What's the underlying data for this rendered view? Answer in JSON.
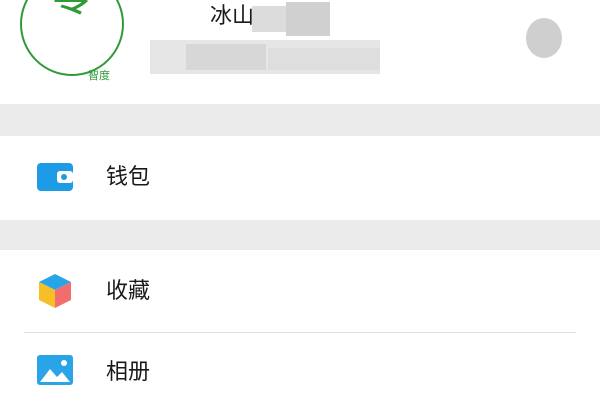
{
  "profile": {
    "avatar_glyph": "零",
    "avatar_caption": "智度",
    "name": "冰山"
  },
  "menu": {
    "items": [
      {
        "label": "钱包",
        "icon": "wallet-icon"
      },
      {
        "label": "收藏",
        "icon": "favorites-cube-icon"
      },
      {
        "label": "相册",
        "icon": "photo-album-icon"
      }
    ]
  },
  "colors": {
    "brand_green": "#2f9a37",
    "wallet_blue": "#1e9be6",
    "section_gray": "#ebebeb",
    "divider": "#dedede"
  }
}
